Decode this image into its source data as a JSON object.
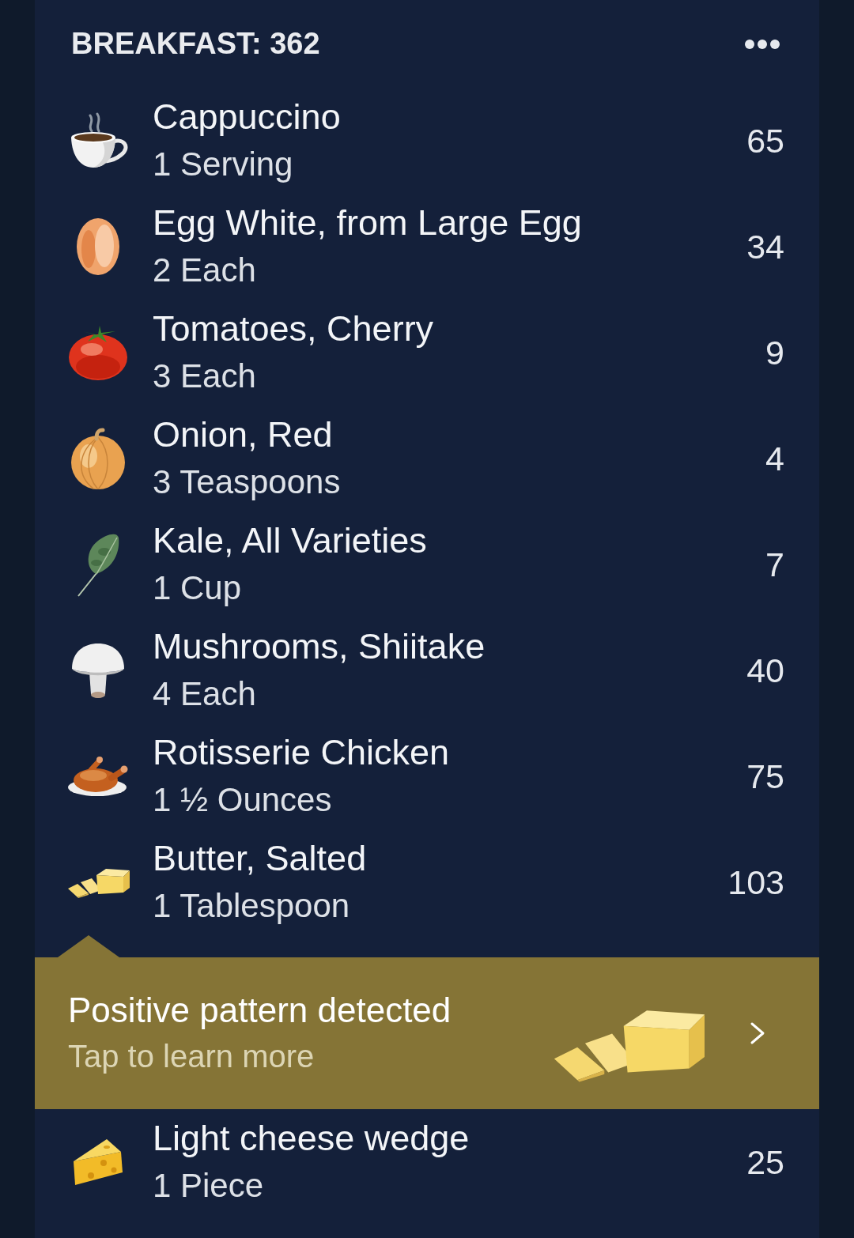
{
  "meal": {
    "title": "BREAKFAST: 362"
  },
  "foods": [
    {
      "kind": "coffee",
      "name": "Cappuccino",
      "serving": "1 Serving",
      "calories": "65"
    },
    {
      "kind": "egg",
      "name": "Egg White, from Large Egg",
      "serving": "2 Each",
      "calories": "34"
    },
    {
      "kind": "tomato",
      "name": "Tomatoes, Cherry",
      "serving": "3 Each",
      "calories": "9"
    },
    {
      "kind": "onion",
      "name": "Onion, Red",
      "serving": "3 Teaspoons",
      "calories": "4"
    },
    {
      "kind": "kale",
      "name": "Kale, All Varieties",
      "serving": "1 Cup",
      "calories": "7"
    },
    {
      "kind": "mushroom",
      "name": "Mushrooms, Shiitake",
      "serving": "4 Each",
      "calories": "40"
    },
    {
      "kind": "chicken",
      "name": "Rotisserie Chicken",
      "serving": "1 ½ Ounces",
      "calories": "75"
    },
    {
      "kind": "butter",
      "name": "Butter, Salted",
      "serving": "1 Tablespoon",
      "calories": "103"
    }
  ],
  "insight": {
    "kind": "butter",
    "title": "Positive pattern detected",
    "subtitle": "Tap to learn more"
  },
  "foods_below": [
    {
      "kind": "cheese",
      "name": "Light cheese wedge",
      "serving": "1 Piece",
      "calories": "25"
    }
  ]
}
